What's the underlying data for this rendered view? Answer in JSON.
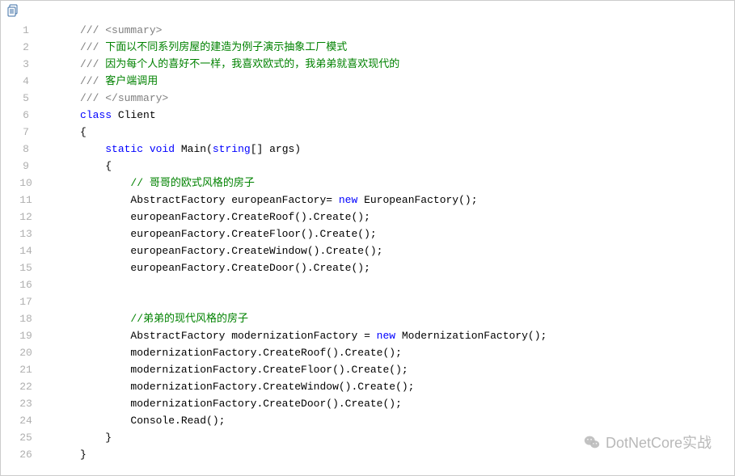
{
  "watermark": "DotNetCore实战",
  "lines": [
    {
      "n": 1,
      "indent": 0,
      "tokens": [
        {
          "t": "summary",
          "v": "/// "
        },
        {
          "t": "summary",
          "v": "<summary>"
        }
      ]
    },
    {
      "n": 2,
      "indent": 0,
      "tokens": [
        {
          "t": "summary",
          "v": "/// "
        },
        {
          "t": "comment",
          "v": "下面以不同系列房屋的建造为例子演示抽象工厂模式"
        }
      ]
    },
    {
      "n": 3,
      "indent": 0,
      "tokens": [
        {
          "t": "summary",
          "v": "/// "
        },
        {
          "t": "comment",
          "v": "因为每个人的喜好不一样，我喜欢欧式的，我弟弟就喜欢现代的"
        }
      ]
    },
    {
      "n": 4,
      "indent": 0,
      "tokens": [
        {
          "t": "summary",
          "v": "/// "
        },
        {
          "t": "comment",
          "v": "客户端调用"
        }
      ]
    },
    {
      "n": 5,
      "indent": 0,
      "tokens": [
        {
          "t": "summary",
          "v": "/// "
        },
        {
          "t": "summary",
          "v": "</summary>"
        }
      ]
    },
    {
      "n": 6,
      "indent": 0,
      "tokens": [
        {
          "t": "keyword",
          "v": "class"
        },
        {
          "t": "plain",
          "v": " Client"
        }
      ]
    },
    {
      "n": 7,
      "indent": 0,
      "tokens": [
        {
          "t": "plain",
          "v": "{"
        }
      ]
    },
    {
      "n": 8,
      "indent": 1,
      "tokens": [
        {
          "t": "keyword",
          "v": "static"
        },
        {
          "t": "plain",
          "v": " "
        },
        {
          "t": "keyword",
          "v": "void"
        },
        {
          "t": "plain",
          "v": " Main("
        },
        {
          "t": "keyword",
          "v": "string"
        },
        {
          "t": "plain",
          "v": "[] args)"
        }
      ]
    },
    {
      "n": 9,
      "indent": 1,
      "tokens": [
        {
          "t": "plain",
          "v": "{"
        }
      ]
    },
    {
      "n": 10,
      "indent": 2,
      "tokens": [
        {
          "t": "comment",
          "v": "// 哥哥的欧式风格的房子"
        }
      ]
    },
    {
      "n": 11,
      "indent": 2,
      "tokens": [
        {
          "t": "plain",
          "v": "AbstractFactory europeanFactory= "
        },
        {
          "t": "keyword",
          "v": "new"
        },
        {
          "t": "plain",
          "v": " EuropeanFactory();"
        }
      ]
    },
    {
      "n": 12,
      "indent": 2,
      "tokens": [
        {
          "t": "plain",
          "v": "europeanFactory.CreateRoof().Create();"
        }
      ]
    },
    {
      "n": 13,
      "indent": 2,
      "tokens": [
        {
          "t": "plain",
          "v": "europeanFactory.CreateFloor().Create();"
        }
      ]
    },
    {
      "n": 14,
      "indent": 2,
      "tokens": [
        {
          "t": "plain",
          "v": "europeanFactory.CreateWindow().Create();"
        }
      ]
    },
    {
      "n": 15,
      "indent": 2,
      "tokens": [
        {
          "t": "plain",
          "v": "europeanFactory.CreateDoor().Create();"
        }
      ]
    },
    {
      "n": 16,
      "indent": 0,
      "tokens": []
    },
    {
      "n": 17,
      "indent": 0,
      "tokens": []
    },
    {
      "n": 18,
      "indent": 2,
      "tokens": [
        {
          "t": "comment",
          "v": "//弟弟的现代风格的房子"
        }
      ]
    },
    {
      "n": 19,
      "indent": 2,
      "tokens": [
        {
          "t": "plain",
          "v": "AbstractFactory modernizationFactory = "
        },
        {
          "t": "keyword",
          "v": "new"
        },
        {
          "t": "plain",
          "v": " ModernizationFactory();"
        }
      ]
    },
    {
      "n": 20,
      "indent": 2,
      "tokens": [
        {
          "t": "plain",
          "v": "modernizationFactory.CreateRoof().Create();"
        }
      ]
    },
    {
      "n": 21,
      "indent": 2,
      "tokens": [
        {
          "t": "plain",
          "v": "modernizationFactory.CreateFloor().Create();"
        }
      ]
    },
    {
      "n": 22,
      "indent": 2,
      "tokens": [
        {
          "t": "plain",
          "v": "modernizationFactory.CreateWindow().Create();"
        }
      ]
    },
    {
      "n": 23,
      "indent": 2,
      "tokens": [
        {
          "t": "plain",
          "v": "modernizationFactory.CreateDoor().Create();"
        }
      ]
    },
    {
      "n": 24,
      "indent": 2,
      "tokens": [
        {
          "t": "plain",
          "v": "Console.Read();"
        }
      ]
    },
    {
      "n": 25,
      "indent": 1,
      "tokens": [
        {
          "t": "plain",
          "v": "}"
        }
      ]
    },
    {
      "n": 26,
      "indent": 0,
      "tokens": [
        {
          "t": "plain",
          "v": "}"
        }
      ]
    }
  ]
}
